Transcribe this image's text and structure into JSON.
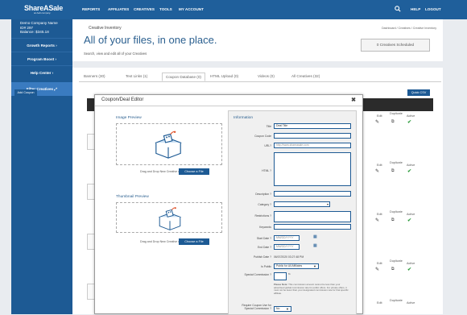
{
  "brand": {
    "logo": "ShareASale",
    "tagline": "an Awin company"
  },
  "nav": [
    "REPORTS",
    "AFFILIATES",
    "CREATIVES",
    "TOOLS",
    "MY ACCOUNT"
  ],
  "topright": {
    "help": "HELP",
    "logout": "LOGOUT"
  },
  "account": {
    "name": "Demo Company Name",
    "id": "ID# 297",
    "balance": "Balance: $345.18"
  },
  "sidebar": {
    "items": [
      "Growth Reports",
      "Program Boost",
      "Help Center",
      "Filter Creatives"
    ]
  },
  "header": {
    "breadcrumb": "Dashboard / Creatives / Creative Inventory",
    "subtitle": "Creative Inventory",
    "title": "All of your files, in one place.",
    "description": "Search, view and edit all of your Creatives",
    "scheduled": "0 Creatives Scheduled"
  },
  "tabs": [
    "Banners (30)",
    "Text Links (1)",
    "Coupon Database (0)",
    "HTML Upload (0)",
    "Videos (0)",
    "All Creatives (32)"
  ],
  "buttons": {
    "add_coupon": "Add Coupon",
    "quick_csv": "Quick CSV"
  },
  "row_labels": {
    "edit": "Edit",
    "duplicate": "Duplicate",
    "active": "Active"
  },
  "modal": {
    "title": "Coupon/Deal Editor",
    "image_preview": "Image Preview",
    "thumbnail_preview": "Thumbnail Preview",
    "drag_text": "Drag and Drop New Creative or",
    "choose_file": "Choose a File",
    "info_title": "Information",
    "fields": {
      "title_label": "Title",
      "title_value": "Deal Title",
      "coupon_code_label": "Coupon Code",
      "url_label": "URL?",
      "url_value": "http://www.shareasale.com",
      "html_label": "HTML ?",
      "description_label": "Description ?",
      "category_label": "Category ?",
      "restrictions_label": "Restrictions ?",
      "keywords_label": "Keywords",
      "start_label": "Start Date ?",
      "start_value": "MM/DD/YYYY",
      "end_label": "End Date ?",
      "end_value": "MM/DD/YYYY",
      "publish_label": "Publish Date ?",
      "publish_value": "06/07/2020 03:27:48 PM",
      "public_label": "Is Public",
      "public_value": "Public for All Affiliates",
      "special_label": "Special Commission ?",
      "special_value": "%",
      "note_bold": "Please Note:",
      "note_text": "This commission amount cannot be less than your advertised global commission rate for public offers. For private offers, it must not be lower than your designated commission rate for that specific affiliate.",
      "require_label": "Require Coupon Use for Special Commission ?",
      "require_value": "No"
    }
  }
}
